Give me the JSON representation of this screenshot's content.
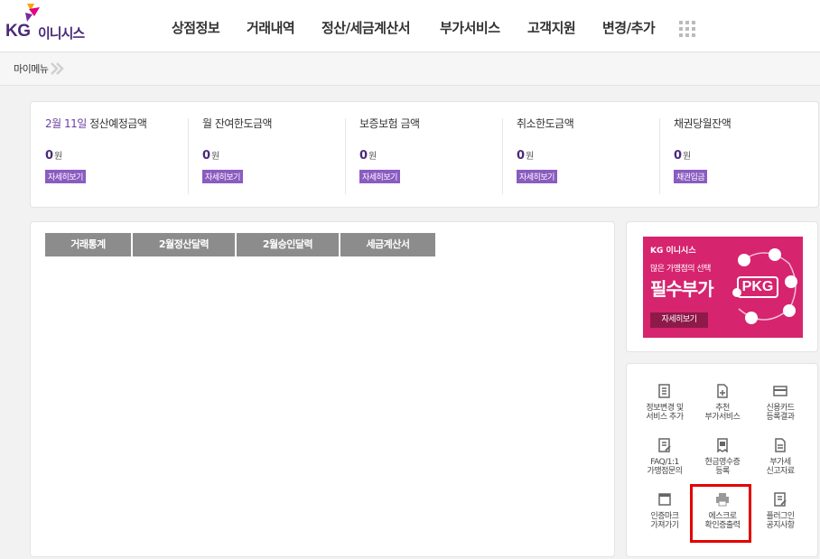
{
  "header": {
    "logo_kg": "KG",
    "logo_text": "이니시스",
    "nav": [
      "상점정보",
      "거래내역",
      "정산/세금계산서",
      "부가서비스",
      "고객지원",
      "변경/추가"
    ]
  },
  "breadcrumb": "마이메뉴",
  "summary": [
    {
      "date": "2월 11일",
      "title": "정산예정금액",
      "amount": "0",
      "unit": "원",
      "button": "자세히보기"
    },
    {
      "date": "",
      "title": "월 잔여한도금액",
      "amount": "0",
      "unit": "원",
      "button": "자세히보기"
    },
    {
      "date": "",
      "title": "보증보험 금액",
      "amount": "0",
      "unit": "원",
      "button": "자세히보기"
    },
    {
      "date": "",
      "title": "취소한도금액",
      "amount": "0",
      "unit": "원",
      "button": "자세히보기"
    },
    {
      "date": "",
      "title": "채권당월잔액",
      "amount": "0",
      "unit": "원",
      "button": "채권입금"
    }
  ],
  "tabs": [
    "거래통계",
    "2월정산달력",
    "2월승인달력",
    "세금계산서"
  ],
  "banner": {
    "logo": "KG 이니시스",
    "subtitle": "많은 가맹점의 선택",
    "title": "필수부가",
    "pkg": "PKG",
    "button": "자세히보기",
    "color": "#d6246f"
  },
  "quick_menu": [
    {
      "label": "정보변경 및\n서비스 추가",
      "icon": "list-icon"
    },
    {
      "label": "추천\n부가서비스",
      "icon": "document-plus-icon"
    },
    {
      "label": "신용카드\n등록결과",
      "icon": "credit-card-icon"
    },
    {
      "label": "FAQ/1:1\n가맹점문의",
      "icon": "edit-document-icon"
    },
    {
      "label": "현금영수증\n등록",
      "icon": "receipt-icon"
    },
    {
      "label": "부가세\n신고자료",
      "icon": "document-icon"
    },
    {
      "label": "인증마크\n가져가기",
      "icon": "window-icon"
    },
    {
      "label": "에스크로\n확인증출력",
      "icon": "printer-icon"
    },
    {
      "label": "플러그인\n공지사항",
      "icon": "notice-icon"
    }
  ],
  "colors": {
    "brand_purple": "#4a2a7a",
    "badge_purple": "#8a5cc0",
    "tab_gray": "#8c8c8c",
    "highlight_red": "#e30000"
  }
}
